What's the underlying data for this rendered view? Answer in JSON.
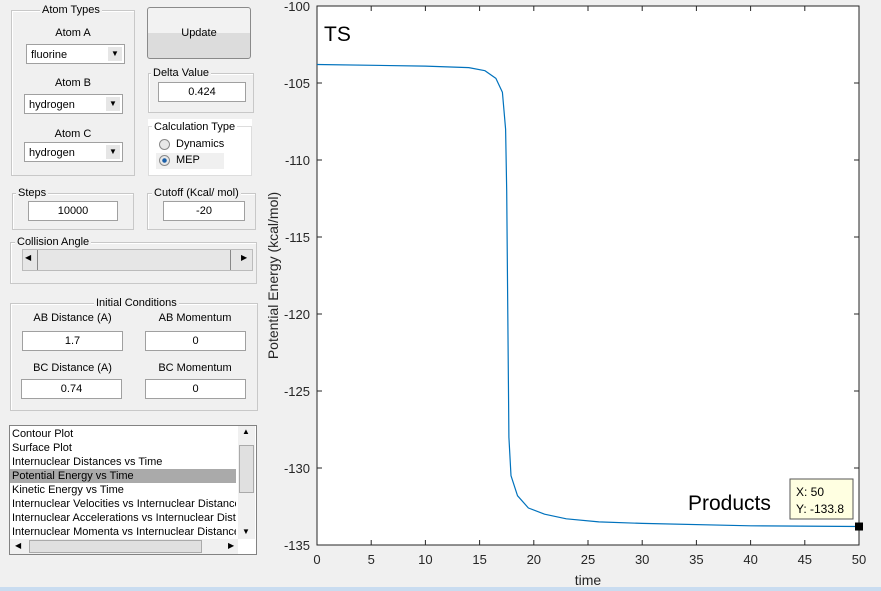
{
  "atom_types": {
    "title": "Atom Types",
    "atom_a_label": "Atom A",
    "atom_a": "fluorine",
    "atom_b_label": "Atom B",
    "atom_b": "hydrogen",
    "atom_c_label": "Atom C",
    "atom_c": "hydrogen"
  },
  "update_label": "Update",
  "delta": {
    "title": "Delta Value",
    "value": "0.424"
  },
  "calc_type": {
    "title": "Calculation Type",
    "options": [
      "Dynamics",
      "MEP"
    ],
    "selected": "MEP"
  },
  "steps": {
    "title": "Steps",
    "value": "10000"
  },
  "cutoff": {
    "title": "Cutoff (Kcal/ mol)",
    "value": "-20"
  },
  "collision": {
    "title": "Collision Angle",
    "slider_fraction": 0.0
  },
  "initial": {
    "title": "Initial Conditions",
    "ab_dist_label": "AB Distance (A)",
    "ab_dist": "1.7",
    "ab_mom_label": "AB Momentum",
    "ab_mom": "0",
    "bc_dist_label": "BC Distance (A)",
    "bc_dist": "0.74",
    "bc_mom_label": "BC Momentum",
    "bc_mom": "0"
  },
  "plot_list": {
    "items": [
      "Contour Plot",
      "Surface Plot",
      "Internuclear Distances vs Time",
      "Potential Energy vs Time",
      "Kinetic Energy vs Time",
      "Internuclear Velocities vs Internuclear Distance",
      "Internuclear Accelerations vs Internuclear Distance",
      "Internuclear Momenta vs Internuclear Distance"
    ],
    "selected_index": 3
  },
  "chart_data": {
    "type": "line",
    "xlabel": "time",
    "ylabel": "Potential Energy (kcal/mol)",
    "xlim": [
      0,
      50
    ],
    "ylim": [
      -135,
      -100
    ],
    "xticks": [
      0,
      5,
      10,
      15,
      20,
      25,
      30,
      35,
      40,
      45,
      50
    ],
    "yticks": [
      -100,
      -105,
      -110,
      -115,
      -120,
      -125,
      -130,
      -135
    ],
    "color": "#0072bd",
    "x": [
      0,
      10,
      14,
      15.5,
      16.5,
      17.1,
      17.4,
      17.5,
      17.6,
      17.7,
      17.9,
      18.5,
      19.5,
      21,
      23,
      26,
      30,
      40,
      50
    ],
    "y": [
      -103.8,
      -103.9,
      -104.0,
      -104.2,
      -104.7,
      -105.6,
      -108,
      -112,
      -120,
      -128,
      -130.5,
      -131.8,
      -132.6,
      -133.0,
      -133.3,
      -133.5,
      -133.6,
      -133.75,
      -133.8
    ],
    "annotations": {
      "ts": "TS",
      "products": "Products"
    },
    "datatip": {
      "x_text": "X: 50",
      "y_text": "Y: -133.8",
      "x": 50,
      "y": -133.8
    }
  }
}
